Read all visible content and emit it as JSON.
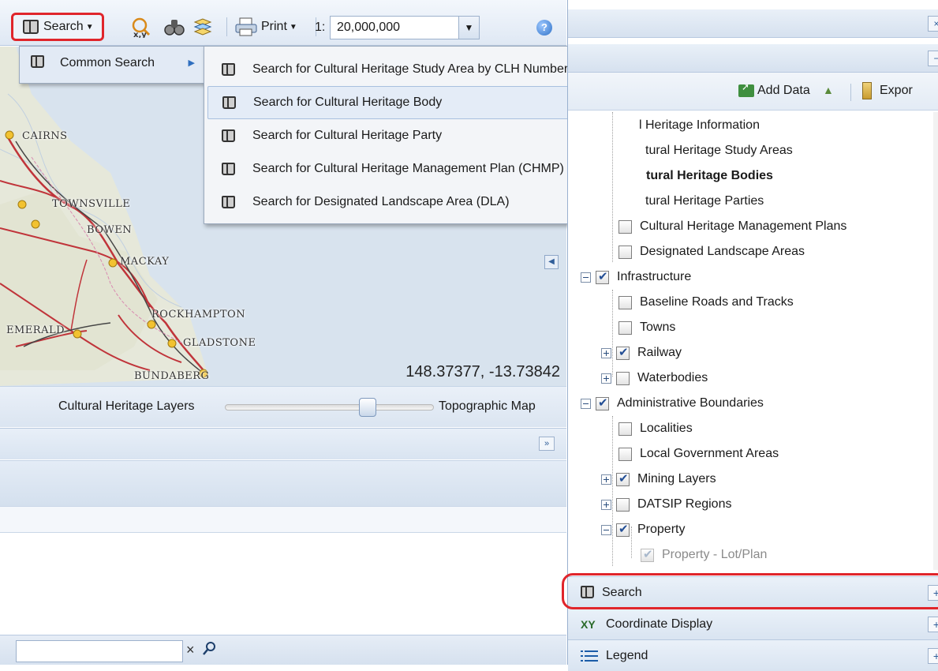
{
  "toolbar": {
    "search_label": "Search",
    "print_label": "Print",
    "scale_prefix": "1:",
    "scale_value": "20,000,000"
  },
  "search_menu": {
    "common_search_label": "Common Search",
    "items": [
      "Search for Cultural Heritage Study Area by CLH Number",
      "Search for Cultural Heritage Body",
      "Search for Cultural Heritage Party",
      "Search for Cultural Heritage Management Plan (CHMP)",
      "Search for Designated Landscape Area (DLA)"
    ],
    "highlighted_index": 1
  },
  "map": {
    "towns": [
      "CAIRNS",
      "TOWNSVILLE",
      "BOWEN",
      "MACKAY",
      "ROCKHAMPTON",
      "EMERALD",
      "GLADSTONE",
      "BUNDABERG"
    ],
    "coordinates": "148.37377, -13.73842"
  },
  "basemap_slider": {
    "left_label": "Cultural Heritage Layers",
    "right_label": "Topographic Map"
  },
  "layers_panel": {
    "add_data_label": "Add Data",
    "export_label": "Expor",
    "tree": {
      "cultural_heritage_information": "l Heritage Information",
      "cultural_heritage_study_areas": "tural Heritage Study Areas",
      "cultural_heritage_bodies": "tural Heritage Bodies",
      "cultural_heritage_parties": "tural Heritage Parties",
      "cultural_heritage_management_plans": "Cultural Heritage Management Plans",
      "designated_landscape_areas": "Designated Landscape Areas",
      "infrastructure": "Infrastructure",
      "baseline_roads_and_tracks": "Baseline Roads and Tracks",
      "towns": "Towns",
      "railway": "Railway",
      "waterbodies": "Waterbodies",
      "administrative_boundaries": "Administrative Boundaries",
      "localities": "Localities",
      "local_government_areas": "Local Government Areas",
      "mining_layers": "Mining Layers",
      "datsip_regions": "DATSIP Regions",
      "property": "Property",
      "property_lot_plan": "Property - Lot/Plan"
    }
  },
  "accordion": {
    "search": "Search",
    "coordinate_display": "Coordinate Display",
    "legend": "Legend"
  },
  "icons": {
    "search": "binoculars-icon",
    "help": "help-icon",
    "print": "printer-icon"
  },
  "colors": {
    "highlight_outline": "#e0252b",
    "panel_blue": "#d9e4f1"
  }
}
